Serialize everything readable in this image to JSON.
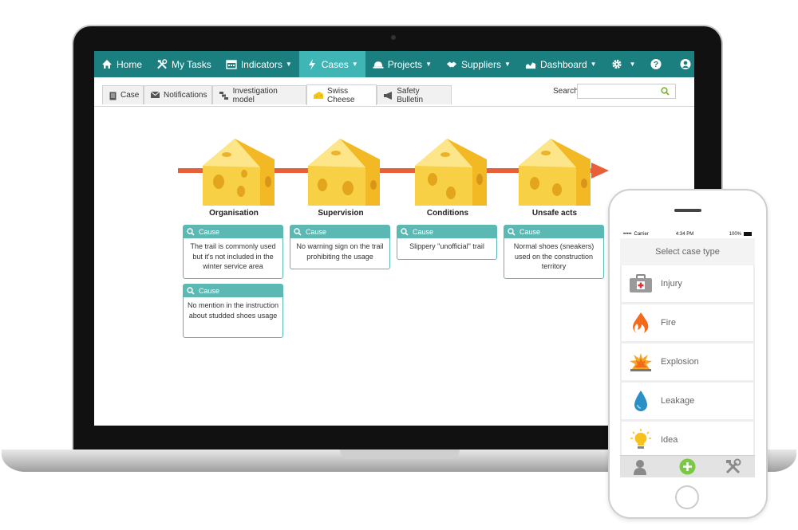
{
  "topnav": {
    "items": [
      {
        "label": "Home",
        "icon": "home-icon"
      },
      {
        "label": "My Tasks",
        "icon": "tools-icon"
      },
      {
        "label": "Indicators",
        "icon": "calendar-icon",
        "caret": true
      },
      {
        "label": "Cases",
        "icon": "lightning-icon",
        "caret": true,
        "active": true
      },
      {
        "label": "Projects",
        "icon": "helmet-icon",
        "caret": true
      },
      {
        "label": "Suppliers",
        "icon": "handshake-icon",
        "caret": true
      },
      {
        "label": "Dashboard",
        "icon": "chart-icon",
        "caret": true
      }
    ],
    "accent_color": "#1c7f7f",
    "active_color": "#3fb5b5"
  },
  "tabs": {
    "items": [
      "Case",
      "Notifications",
      "Investigation model",
      "Swiss Cheese",
      "Safety Bulletin"
    ],
    "active": "Swiss Cheese"
  },
  "search": {
    "label": "Search",
    "value": ""
  },
  "diagram": {
    "columns": [
      {
        "title": "Organisation",
        "causes": [
          "The trail is commonly used but it's not included in the winter service area",
          "No mention in the instruction about studded shoes usage"
        ]
      },
      {
        "title": "Supervision",
        "causes": [
          "No warning sign on the trail prohibiting the usage"
        ]
      },
      {
        "title": "Conditions",
        "causes": [
          "Slippery \"unofficial\" trail"
        ]
      },
      {
        "title": "Unsafe acts",
        "causes": [
          "Normal shoes (sneakers) used on the construction territory"
        ]
      }
    ],
    "cause_label": "Cause",
    "cause_color": "#5cb8b2",
    "arrow_color": "#e8603a"
  },
  "phone": {
    "status": {
      "carrier": "Carrier",
      "time": "4:34 PM",
      "battery": "100%"
    },
    "header": "Select case type",
    "case_types": [
      {
        "label": "Injury",
        "icon": "first-aid-kit-icon"
      },
      {
        "label": "Fire",
        "icon": "flame-icon"
      },
      {
        "label": "Explosion",
        "icon": "explosion-icon"
      },
      {
        "label": "Leakage",
        "icon": "drop-icon"
      },
      {
        "label": "Idea",
        "icon": "lightbulb-icon"
      }
    ]
  }
}
